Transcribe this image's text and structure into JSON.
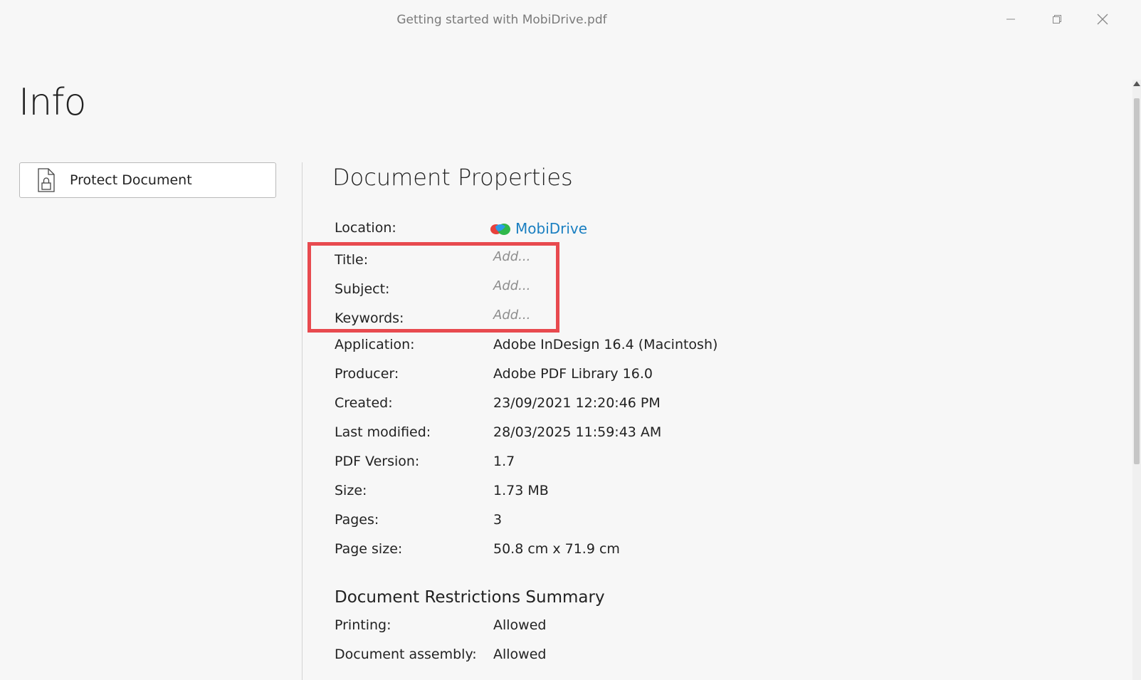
{
  "window": {
    "title": "Getting started with MobiDrive.pdf"
  },
  "page": {
    "heading": "Info"
  },
  "actions": {
    "protect_label": "Protect Document"
  },
  "properties": {
    "title": "Document Properties",
    "location_label": "Location:",
    "location_value": "MobiDrive",
    "title_label": "Title:",
    "title_placeholder": "Add...",
    "subject_label": "Subject:",
    "subject_placeholder": "Add...",
    "keywords_label": "Keywords:",
    "keywords_placeholder": "Add...",
    "application_label": "Application:",
    "application_value": "Adobe InDesign 16.4 (Macintosh)",
    "producer_label": "Producer:",
    "producer_value": "Adobe PDF Library 16.0",
    "created_label": "Created:",
    "created_value": "23/09/2021 12:20:46 PM",
    "modified_label": "Last modified:",
    "modified_value": "28/03/2025 11:59:43 AM",
    "pdf_version_label": "PDF Version:",
    "pdf_version_value": "1.7",
    "size_label": "Size:",
    "size_value": "1.73 MB",
    "pages_label": "Pages:",
    "pages_value": "3",
    "page_size_label": "Page size:",
    "page_size_value": "50.8 cm x 71.9 cm"
  },
  "restrictions": {
    "title": "Document Restrictions Summary",
    "printing_label": "Printing:",
    "printing_value": "Allowed",
    "assembly_label": "Document assembly:",
    "assembly_value": "Allowed"
  },
  "colors": {
    "accent_link": "#1a7fc1",
    "highlight": "#e84a4f"
  },
  "icons": {
    "protect": "lock-document-icon",
    "location": "mobidrive-logo-icon",
    "minimize": "minimize-icon",
    "restore": "restore-icon",
    "close": "close-icon"
  }
}
